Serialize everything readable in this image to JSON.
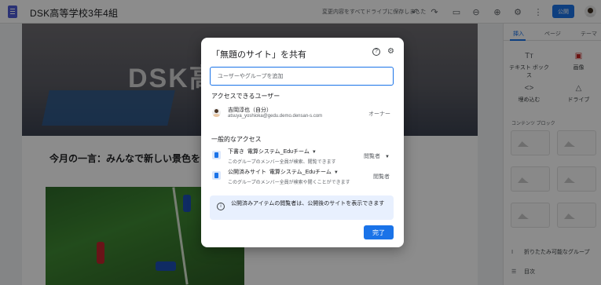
{
  "topbar": {
    "site_title": "DSK高等学校3年4組",
    "save_status": "変更内容をすべてドライブに保存しました",
    "publish_label": "公開",
    "icons": [
      "undo-icon",
      "redo-icon",
      "preview-icon",
      "link-icon",
      "share-icon",
      "gear-icon",
      "more-icon"
    ]
  },
  "page": {
    "hero_text": "DSK高",
    "monthly_text": "今月の一言：みんなで新しい景色を"
  },
  "sidebar": {
    "tabs": [
      {
        "label": "挿入"
      },
      {
        "label": "ページ"
      },
      {
        "label": "テーマ"
      }
    ],
    "items": [
      {
        "label": "テキスト ボックス",
        "icon": "Tт"
      },
      {
        "label": "画像",
        "icon": "▣"
      },
      {
        "label": "埋め込む",
        "icon": "<>"
      },
      {
        "label": "ドライブ",
        "icon": "△"
      }
    ],
    "section_label": "コンテンツ ブロック",
    "rows": [
      {
        "label": "折りたたみ可能なグループ",
        "icon": "Ⅰ"
      },
      {
        "label": "目次",
        "icon": "☰"
      }
    ]
  },
  "dialog": {
    "title": "「無題のサイト」を共有",
    "input_placeholder": "ユーザーやグループを追加",
    "access_users_heading": "アクセスできるユーザー",
    "user": {
      "name": "吉岡淳也（自分）",
      "email": "atsuya_yoshioka@gedu.demo.densan-s.com",
      "role": "オーナー"
    },
    "general_heading": "一般的なアクセス",
    "draft": {
      "prefix": "下書き",
      "group": "電算システム_Eduチーム",
      "desc": "このグループのメンバー全員が検索、閲覧できます",
      "role": "閲覧者"
    },
    "published": {
      "prefix": "公開済みサイト",
      "group": "電算システム_Eduチーム",
      "desc": "このグループのメンバー全員が検索や閲くことができます",
      "role": "閲覧者"
    },
    "notice": "公開済みアイテムの閲覧者は、公開後のサイトを表示できます",
    "done_label": "完了"
  }
}
